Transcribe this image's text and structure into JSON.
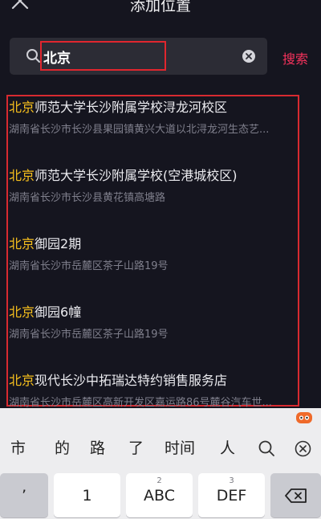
{
  "header": {
    "title": "添加位置"
  },
  "search": {
    "value": "北京",
    "button_label": "搜索"
  },
  "results": [
    {
      "highlight": "北京",
      "rest": "师范大学长沙附属学校浔龙河校区",
      "address": "湖南省长沙市长沙县果园镇黄兴大道以北浔龙河生态艺..."
    },
    {
      "highlight": "北京",
      "rest": "师范大学长沙附属学校(空港城校区)",
      "address": "湖南省长沙市长沙县黄花镇高塘路"
    },
    {
      "highlight": "北京",
      "rest": "御园2期",
      "address": "湖南省长沙市岳麓区茶子山路19号"
    },
    {
      "highlight": "北京",
      "rest": "御园6幢",
      "address": "湖南省长沙市岳麓区茶子山路19号"
    },
    {
      "highlight": "北京",
      "rest": "现代长沙中拓瑞达特约销售服务店",
      "address": "湖南省长沙市岳麓区高新开发区嘉运路86号麓谷汽车世..."
    }
  ],
  "keyboard": {
    "candidates": [
      "市",
      "的",
      "路",
      "了",
      "时间",
      "人"
    ],
    "keys": [
      {
        "sup": "",
        "label": "’"
      },
      {
        "sup": "",
        "label": "1"
      },
      {
        "sup": "2",
        "label": "ABC"
      },
      {
        "sup": "3",
        "label": "DEF"
      }
    ]
  },
  "colors": {
    "highlight": "#f7c01d",
    "accent": "#f6325c",
    "annotation": "#e0262e"
  }
}
